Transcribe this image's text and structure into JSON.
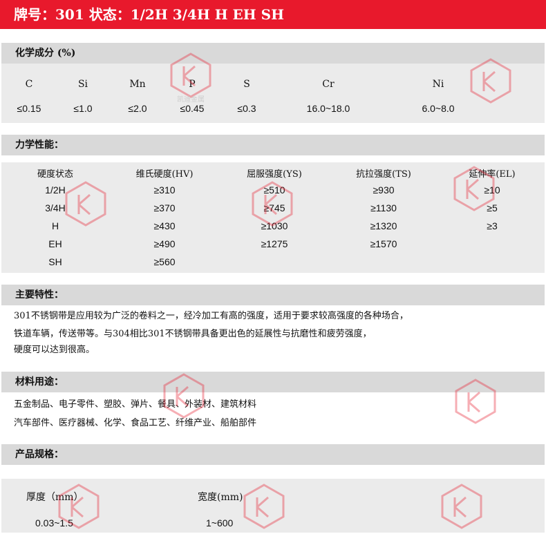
{
  "title": "牌号：301 状态：1/2H  3/4H  H  EH  SH",
  "watermark_text": "凯迪金属",
  "chemical": {
    "header": "化学成分 (%)",
    "elements": [
      "C",
      "Si",
      "Mn",
      "P",
      "S",
      "Cr",
      "Ni"
    ],
    "values": [
      "≤0.15",
      "≤1.0",
      "≤2.0",
      "≤0.45",
      "≤0.3",
      "16.0~18.0",
      "6.0~8.0"
    ]
  },
  "mechanical": {
    "header": "力学性能：",
    "columns": [
      "硬度状态",
      "维氏硬度(HV)",
      "屈服强度(YS)",
      "抗拉强度(TS)",
      "延伸率(EL)"
    ],
    "rows": [
      [
        "1/2H",
        "≥310",
        "≥510",
        "≥930",
        "≥10"
      ],
      [
        "3/4H",
        "≥370",
        "≥745",
        "≥1130",
        "≥5"
      ],
      [
        "H",
        "≥430",
        "≥1030",
        "≥1320",
        "≥3"
      ],
      [
        "EH",
        "≥490",
        "≥1275",
        "≥1570",
        ""
      ],
      [
        "SH",
        "≥560",
        "",
        "",
        ""
      ]
    ]
  },
  "features": {
    "header": "主要特性：",
    "lines": [
      " 301不锈钢带是应用较为广泛的卷料之一，经冷加工有高的强度，适用于要求较高强度的各种场合，",
      "铁道车辆，传送带等。与304相比301不锈钢带具备更出色的延展性与抗磨性和疲劳强度，",
      "硬度可以达到很高。"
    ]
  },
  "uses": {
    "header": "材料用途：",
    "lines": [
      "五金制品、电子零件、塑胶、弹片、餐具、外装材、建筑材料",
      "汽车部件、医疗器械、化学、食品工艺、纤维产业、船舶部件"
    ]
  },
  "specs": {
    "header": "产品规格：",
    "columns": [
      "厚度（mm）",
      "宽度(mm)"
    ],
    "values": [
      "0.03~1.5",
      "1~600"
    ]
  },
  "colors": {
    "accent": "#e8192c",
    "header_bg": "#d9d9d9",
    "body_bg": "#ebebeb"
  }
}
